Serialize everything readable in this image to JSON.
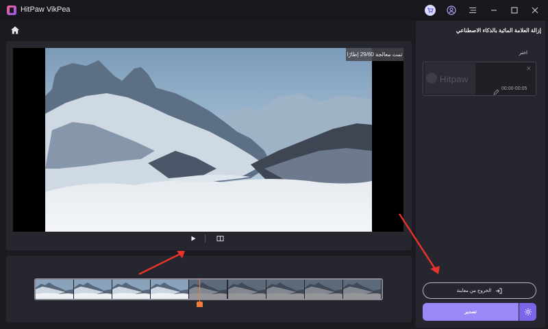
{
  "app": {
    "title": "HitPaw VikPea"
  },
  "titlebar": {
    "icons": [
      "cart-icon",
      "user-icon",
      "menu-icon",
      "minimize-icon",
      "maximize-icon",
      "close-icon"
    ]
  },
  "preview": {
    "processed_badge": "تمت معالجة 29/60 إطارًا",
    "controls": [
      "play-icon",
      "compare-icon"
    ]
  },
  "timeline": {
    "thumb_count": 9,
    "processed_fraction": 0.47
  },
  "panel": {
    "title": "إزالة العلامة المائية بالذكاء الاصطناعي",
    "select_label": "اختر",
    "clip": {
      "thumb_text": "Hitpaw",
      "time_range": "00:00-00:05"
    },
    "exit_preview_label": "الخروج من معاينة",
    "export_label": "تصدير"
  },
  "colors": {
    "accent": "#9b87f5",
    "accent_dark": "#7b66e8",
    "playhead": "#f07c3c",
    "annotation_arrow": "#e8322b"
  }
}
